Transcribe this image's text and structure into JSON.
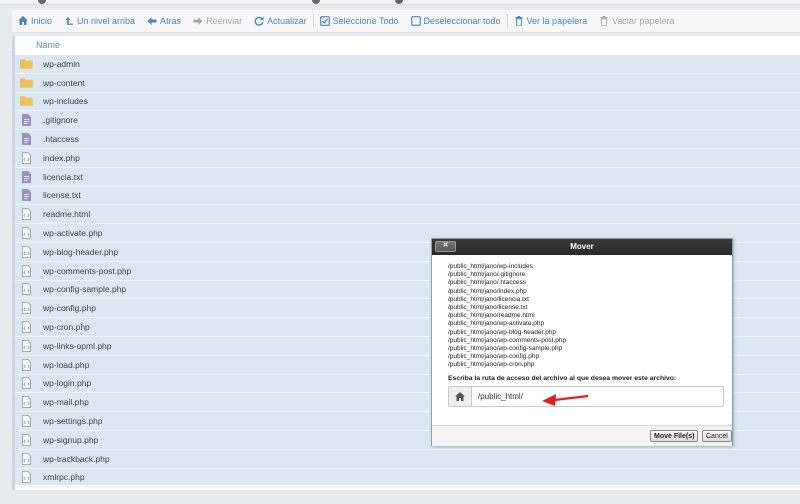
{
  "toolbar": {
    "items": [
      {
        "label": "Inicio",
        "icon": "home-icon",
        "enabled": true
      },
      {
        "label": "Un nivel arriba",
        "icon": "level-up-icon",
        "enabled": true
      },
      {
        "label": "Atrás",
        "icon": "arrow-left-icon",
        "enabled": true
      },
      {
        "label": "Reenviar",
        "icon": "arrow-right-icon",
        "enabled": false
      },
      {
        "label": "Actualizar",
        "icon": "refresh-icon",
        "enabled": true
      },
      {
        "label": "Seleccione Todo",
        "icon": "checkbox-checked-icon",
        "enabled": true
      },
      {
        "label": "Deseleccionar todo",
        "icon": "checkbox-empty-icon",
        "enabled": true
      },
      {
        "label": "Ver la papelera",
        "icon": "trash-icon",
        "enabled": true
      },
      {
        "label": "Vaciar papelera",
        "icon": "trash-icon",
        "enabled": false
      }
    ]
  },
  "filelist": {
    "column_header": "Name",
    "files": [
      {
        "name": "wp-admin",
        "type": "folder"
      },
      {
        "name": "wp-content",
        "type": "folder"
      },
      {
        "name": "wp-includes",
        "type": "folder"
      },
      {
        "name": ".gitignore",
        "type": "text"
      },
      {
        "name": ".htaccess",
        "type": "text"
      },
      {
        "name": "index.php",
        "type": "code"
      },
      {
        "name": "licencia.txt",
        "type": "text"
      },
      {
        "name": "license.txt",
        "type": "text"
      },
      {
        "name": "readme.html",
        "type": "code"
      },
      {
        "name": "wp-activate.php",
        "type": "code"
      },
      {
        "name": "wp-blog-header.php",
        "type": "code"
      },
      {
        "name": "wp-comments-post.php",
        "type": "code"
      },
      {
        "name": "wp-config-sample.php",
        "type": "code"
      },
      {
        "name": "wp-config.php",
        "type": "code"
      },
      {
        "name": "wp-cron.php",
        "type": "code"
      },
      {
        "name": "wp-links-opml.php",
        "type": "code"
      },
      {
        "name": "wp-load.php",
        "type": "code"
      },
      {
        "name": "wp-login.php",
        "type": "code"
      },
      {
        "name": "wp-mail.php",
        "type": "code"
      },
      {
        "name": "wp-settings.php",
        "type": "code"
      },
      {
        "name": "wp-signup.php",
        "type": "code"
      },
      {
        "name": "wp-trackback.php",
        "type": "code"
      },
      {
        "name": "xmlrpc.php",
        "type": "code"
      }
    ]
  },
  "modal": {
    "title": "Mover",
    "close_label": "✕",
    "paths": [
      "/public_html/jano/wp-includes",
      "/public_html/jano/.gitignore",
      "/public_html/jano/.htaccess",
      "/public_html/jano/index.php",
      "/public_html/jano/licencia.txt",
      "/public_html/jano/license.txt",
      "/public_html/jano/readme.html",
      "/public_html/jano/wp-activate.php",
      "/public_html/jano/wp-blog-header.php",
      "/public_html/jano/wp-comments-post.php",
      "/public_html/jano/wp-config-sample.php",
      "/public_html/jano/wp-config.php",
      "/public_html/jano/wp-cron.php"
    ],
    "instruction": "Escriba la ruta de acceso del archivo al que desea mover este archivo:",
    "path_value": "/public_html/",
    "move_button": "Move File(s)",
    "cancel_button": "Cancel"
  },
  "colors": {
    "link_blue": "#4a86c4",
    "selected_row": "#dbe8f2",
    "folder": "#f0c15a",
    "file_icon": "#9b8fc9",
    "arrow": "#e02020"
  }
}
